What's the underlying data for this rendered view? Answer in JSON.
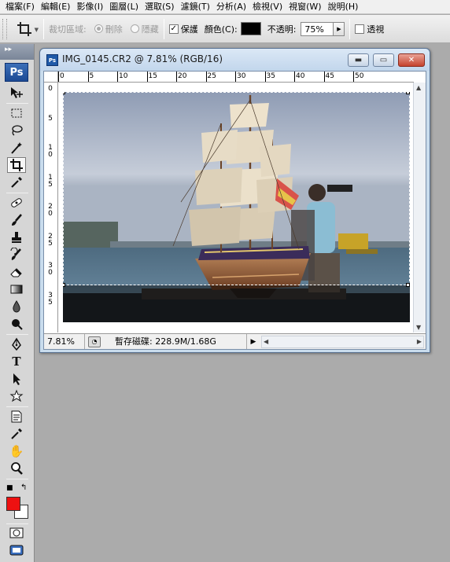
{
  "menu": [
    "檔案(F)",
    "編輯(E)",
    "影像(I)",
    "圖層(L)",
    "選取(S)",
    "濾鏡(T)",
    "分析(A)",
    "檢視(V)",
    "視窗(W)",
    "說明(H)"
  ],
  "options": {
    "crop_area_label": "裁切區域:",
    "delete_label": "刪除",
    "hide_label": "隱藏",
    "shield_label": "保護",
    "shield_checked": true,
    "color_label": "顏色(C):",
    "shield_color": "#000000",
    "opacity_label": "不透明:",
    "opacity_value": "75%",
    "perspective_label": "透視",
    "perspective_checked": false
  },
  "toolbox": {
    "header": "▸▸",
    "logo": "Ps",
    "foreground_color": "#ee1111",
    "background_color": "#ffffff"
  },
  "document": {
    "title": "IMG_0145.CR2 @ 7.81% (RGB/16)",
    "zoom": "7.81%",
    "scratch_info": "暫存磁碟: 228.9M/1.68G",
    "hruler_labels": [
      "0",
      "5",
      "10",
      "15",
      "20",
      "25",
      "30",
      "35",
      "40",
      "45",
      "50"
    ],
    "vruler_labels": [
      "0",
      "5",
      "10",
      "15",
      "20",
      "25",
      "30",
      "35"
    ]
  }
}
